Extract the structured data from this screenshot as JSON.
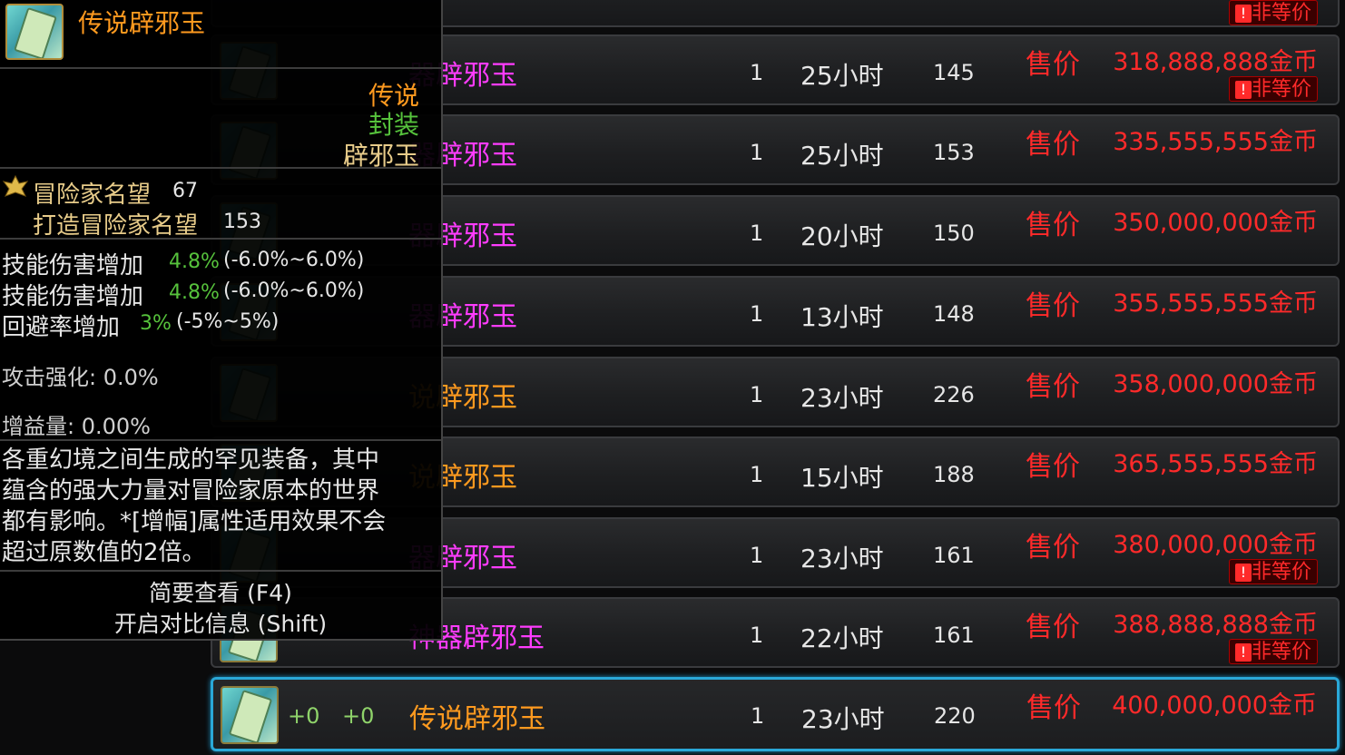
{
  "tooltip": {
    "item_name": "传说辟邪玉",
    "rarity": "传说",
    "bind_status": "封装",
    "item_type": "辟邪玉",
    "fame_label": "冒险家名望",
    "fame_value": "67",
    "forge_fame_label": "打造冒险家名望",
    "forge_fame_value": "153",
    "stats": [
      {
        "label": "技能伤害增加",
        "value": "4.8%",
        "range": "(-6.0%~6.0%)"
      },
      {
        "label": "技能伤害增加",
        "value": "4.8%",
        "range": "(-6.0%~6.0%)"
      },
      {
        "label": "回避率增加",
        "value": "3%",
        "range": "(-5%~5%)"
      }
    ],
    "attack_strength": "攻击强化: 0.0%",
    "buff_amount": "增益量: 0.00%",
    "description": "各重幻境之间生成的罕见装备，其中蕴含的强大力量对冒险家原本的世界都有影响。*[增幅]属性适用效果不会超过原数值的2倍。",
    "footer_line1": "简要查看 (F4)",
    "footer_line2": "开启对比信息 (Shift)"
  },
  "listings": [
    {
      "plus1": "",
      "plus2": "",
      "name": "器辟邪玉",
      "name_color": "magenta",
      "qty": "1",
      "time": "25小时",
      "level": "145",
      "price_label": "售价",
      "price": "318,888,888金币",
      "nontrade": "非等价"
    },
    {
      "plus1": "",
      "plus2": "",
      "name": "器辟邪玉",
      "name_color": "magenta",
      "qty": "1",
      "time": "25小时",
      "level": "153",
      "price_label": "售价",
      "price": "335,555,555金币",
      "nontrade": ""
    },
    {
      "plus1": "",
      "plus2": "",
      "name": "器辟邪玉",
      "name_color": "magenta",
      "qty": "1",
      "time": "20小时",
      "level": "150",
      "price_label": "售价",
      "price": "350,000,000金币",
      "nontrade": ""
    },
    {
      "plus1": "",
      "plus2": "",
      "name": "器辟邪玉",
      "name_color": "magenta",
      "qty": "1",
      "time": "13小时",
      "level": "148",
      "price_label": "售价",
      "price": "355,555,555金币",
      "nontrade": ""
    },
    {
      "plus1": "",
      "plus2": "",
      "name": "说辟邪玉",
      "name_color": "orange",
      "qty": "1",
      "time": "23小时",
      "level": "226",
      "price_label": "售价",
      "price": "358,000,000金币",
      "nontrade": ""
    },
    {
      "plus1": "",
      "plus2": "",
      "name": "说辟邪玉",
      "name_color": "orange",
      "qty": "1",
      "time": "15小时",
      "level": "188",
      "price_label": "售价",
      "price": "365,555,555金币",
      "nontrade": ""
    },
    {
      "plus1": "",
      "plus2": "",
      "name": "器辟邪玉",
      "name_color": "magenta",
      "qty": "1",
      "time": "23小时",
      "level": "161",
      "price_label": "售价",
      "price": "380,000,000金币",
      "nontrade": "非等价"
    },
    {
      "plus1": "",
      "plus2": "",
      "name": "神器辟邪玉",
      "name_color": "magenta",
      "qty": "1",
      "time": "22小时",
      "level": "161",
      "price_label": "售价",
      "price": "388,888,888金币",
      "nontrade": "非等价"
    },
    {
      "plus1": "+0",
      "plus2": "+0",
      "name": "传说辟邪玉",
      "name_color": "orange",
      "qty": "1",
      "time": "23小时",
      "level": "220",
      "price_label": "售价",
      "price": "400,000,000金币",
      "nontrade": ""
    }
  ],
  "top_partial_nontrade": "非等价",
  "colors": {
    "price_red": "#ff2a2a",
    "legendary_orange": "#ff9a1f",
    "epic_magenta": "#ff3cff",
    "stat_green": "#56c23c",
    "selected_border": "#2aa8d8"
  }
}
